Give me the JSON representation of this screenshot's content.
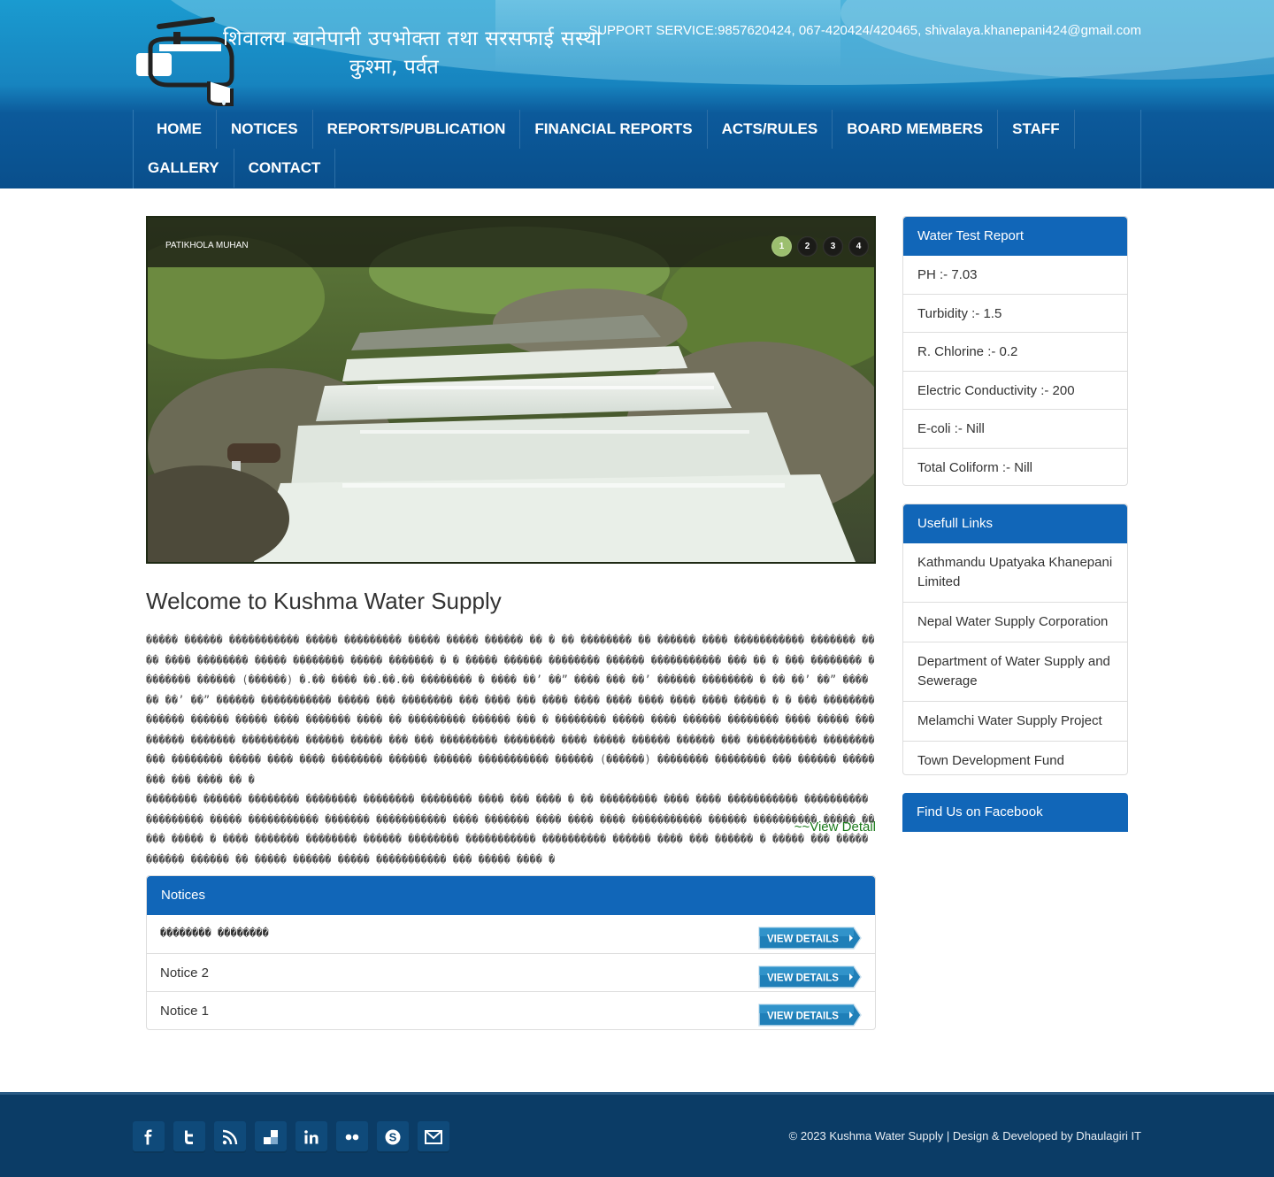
{
  "header": {
    "logo_line1": "शिवालय खानेपानी उपभोक्ता तथा सरसफाई सस्था",
    "logo_line2": "कुश्मा, पर्वत",
    "support_text": "SUPPORT SERVICE:9857620424, 067-420424/420465, shivalaya.khanepani424@gmail.com"
  },
  "nav": {
    "items": [
      "Home",
      "Notices",
      "Reports/Publication",
      "Financial Reports",
      "Acts/Rules",
      "Board Members",
      "Staff",
      "Gallery",
      "Contact"
    ]
  },
  "slider": {
    "caption": "PATIKHOLA MUHAN",
    "dots": [
      "1",
      "2",
      "3",
      "4"
    ],
    "active_dot": "1"
  },
  "welcome": {
    "title": "Welcome to Kushma Water Supply",
    "paragraph1": "����� ������ ����������� ����� ��������� ����� ����� ������ �� � �� �������� �� ������ ���� ����������� ������� ���� ���� �������� ����� �������� ����� ������� � � ����� ������ �������� ������ ����������� ��� �� � ��� �������� �������� ������ (������) �.�� ���� ��.��.�� �������� � ���� ��’ ��” ���� ��� ��’ ������ �������� � �� ��’ ��” ���� �� ��’ ��” ������ ����������� ����� ��� �������� ��� ���� ��� ���� ���� ���� ���� ���� ���� ����� � � ��� �������� ������ ������ ����� ���� ������� ���� �� ��������� ������ ��� � �������� ����� ���� ������ �������� ���� ����� ��������� ������� ��������� ������ ����� ��� ��� ��������� �������� ���� ����� ������ ������ ��� ����������� ����������� �������� ����� ���� ���� �������� ������ ������ ����������� ������ (������) �������� �������� ��� ������ �������� ��� ���� �� �",
    "paragraph2": "�������� ������ �������� �������� �������� �������� ���� ��� ���� � �� ��������� ���� ���� ����������� ���������� ��������� ����� ����������� ������� ����������� ���� ������� ���� ���� ���� ����������� ������ ���������� ����� ����� ����� � ���� ������� �������� ������ �������� ����������� ���������� ������ ���� ��� ������ � ����� ��� ����� ������ ������ �� ����� ������ ����� ����������� ��� ����� ���� �",
    "view_detail": "~~View Detail"
  },
  "notices": {
    "heading": "Notices",
    "items": [
      "�������� ��������",
      "Notice 2",
      "Notice 1"
    ],
    "button_label": "VIEW DETAILS"
  },
  "water_test": {
    "heading": "Water Test Report",
    "items": [
      "PH :- 7.03",
      "Turbidity :- 1.5",
      "R. Chlorine :- 0.2",
      "Electric Conductivity :- 200",
      "E-coli :- Nill",
      "Total Coliform :- Nill"
    ]
  },
  "links": {
    "heading": "Usefull Links",
    "items": [
      "Kathmandu Upatyaka Khanepani Limited",
      "Nepal Water Supply Corporation",
      "Department of Water Supply and Sewerage",
      "Melamchi Water Supply Project",
      "Town Development Fund"
    ]
  },
  "facebook": {
    "heading": "Find Us on Facebook"
  },
  "footer": {
    "social_icons": [
      "facebook-icon",
      "twitter-icon",
      "rss-icon",
      "delicious-icon",
      "linkedin-icon",
      "flickr-icon",
      "skype-icon",
      "email-icon"
    ],
    "copyright": "© 2023 Kushma Water Supply | Design & Developed by Dhaulagiri IT"
  },
  "colors": {
    "header_blue": "#1784bf",
    "panel_blue": "#1166b8",
    "footer_navy": "#0b3c66",
    "link_green": "#1c7a1c"
  }
}
